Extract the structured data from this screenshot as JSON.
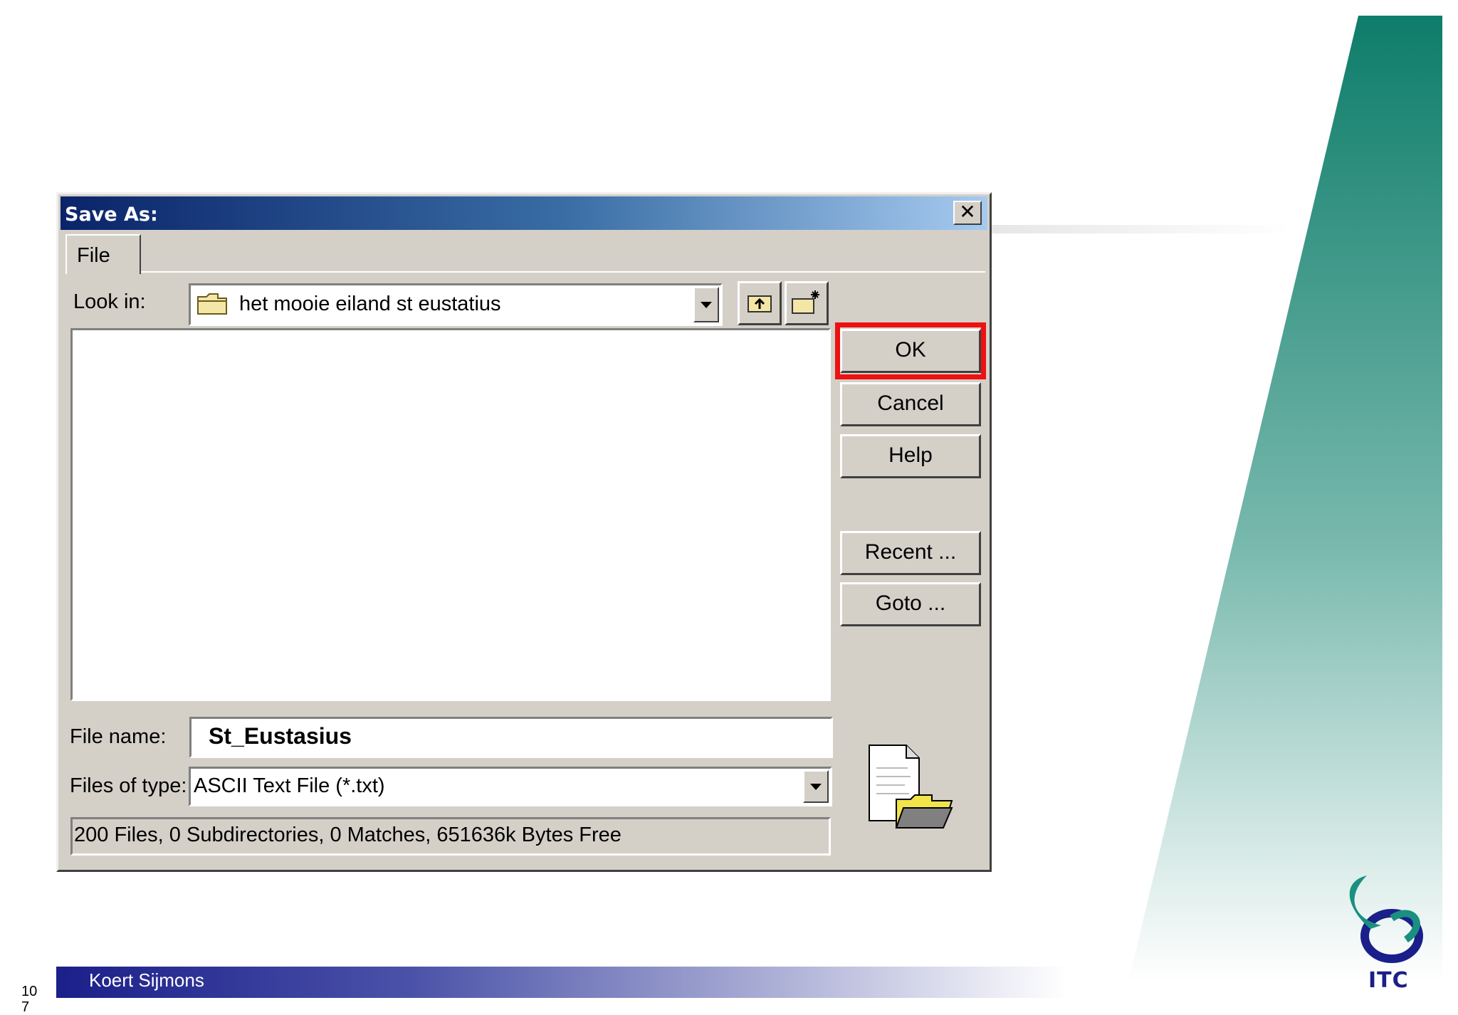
{
  "dialog": {
    "title": "Save As:",
    "close_label": "✕",
    "tab_label": "File",
    "look_in_label": "Look in:",
    "look_in_value": "het mooie eiland st eustatius",
    "file_name_label": "File name:",
    "file_name_value": "St_Eustasius",
    "files_of_type_label": "Files of type:",
    "files_of_type_value": "ASCII Text File (*.txt)",
    "status_text": "200 Files, 0 Subdirectories, 0 Matches, 651636k Bytes Free",
    "buttons": {
      "ok": "OK",
      "cancel": "Cancel",
      "help": "Help",
      "recent": "Recent ...",
      "goto": "Goto ..."
    },
    "highlight_color": "#ee1111"
  },
  "slide": {
    "author": "Koert Sijmons",
    "slide_number": "10\n7",
    "logo_text": "ITC",
    "accent_color": "#0e7d6a",
    "footer_color": "#1b1f8a"
  }
}
